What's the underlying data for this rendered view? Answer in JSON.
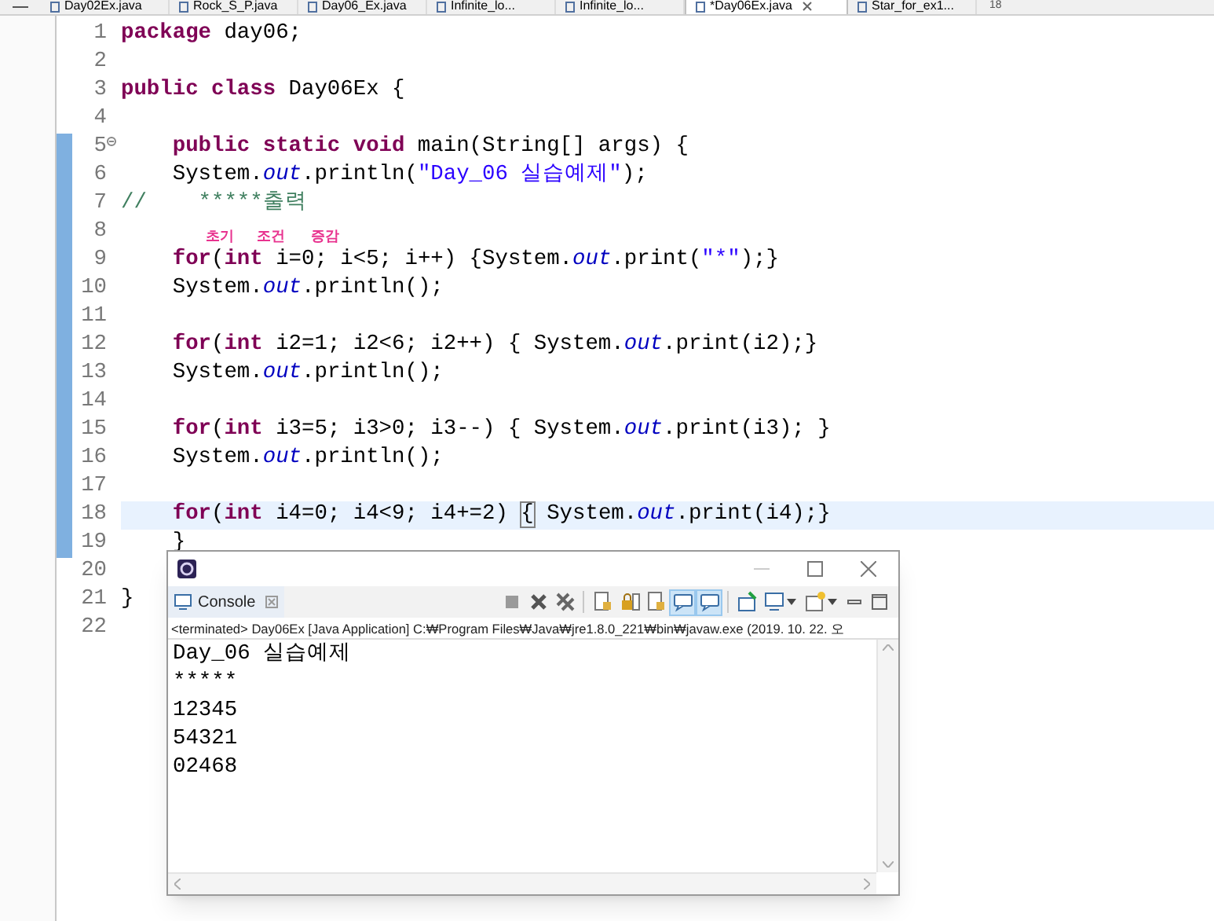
{
  "tabs": [
    {
      "label": "Day02Ex.java",
      "selected": false,
      "closable": false
    },
    {
      "label": "Rock_S_P.java",
      "selected": false,
      "closable": false
    },
    {
      "label": "Day06_Ex.java",
      "selected": false,
      "closable": false
    },
    {
      "label": "Infinite_lo...",
      "selected": false,
      "closable": false
    },
    {
      "label": "Infinite_lo...",
      "selected": false,
      "closable": false
    },
    {
      "label": "*Day06Ex.java",
      "selected": true,
      "closable": true
    },
    {
      "label": "Star_for_ex1...",
      "selected": false,
      "closable": false
    }
  ],
  "overflow_count": "18",
  "editor": {
    "lines": [
      {
        "number": "1",
        "tokens": [
          {
            "kind": "kw",
            "text": "package"
          },
          {
            "kind": "plain",
            "text": " day06;"
          }
        ]
      },
      {
        "number": "2"
      },
      {
        "number": "3",
        "tokens": [
          {
            "kind": "kw",
            "text": "public class"
          },
          {
            "kind": "plain",
            "text": " Day06Ex {"
          }
        ]
      },
      {
        "number": "4"
      },
      {
        "number": "5",
        "folding": true,
        "tokens": [
          {
            "kind": "kw",
            "text": "    public static void"
          },
          {
            "kind": "plain",
            "text": " main(String[] args) {"
          }
        ]
      },
      {
        "number": "6",
        "tokens": [
          {
            "kind": "plain",
            "text": "    System."
          },
          {
            "kind": "field",
            "text": "out"
          },
          {
            "kind": "plain",
            "text": ".println("
          },
          {
            "kind": "str",
            "text": "\"Day_06 실습예제\""
          },
          {
            "kind": "plain",
            "text": ");"
          }
        ]
      },
      {
        "number": "7",
        "tokens": [
          {
            "kind": "comment",
            "text": "//    *****출력"
          }
        ]
      },
      {
        "number": "8",
        "annotations": [
          "초기",
          "조건",
          "증감"
        ]
      },
      {
        "number": "9",
        "tokens": [
          {
            "kind": "kw",
            "text": "    for"
          },
          {
            "kind": "plain",
            "text": "("
          },
          {
            "kind": "kw",
            "text": "int"
          },
          {
            "kind": "plain",
            "text": " i=0; i<5; i++) {System."
          },
          {
            "kind": "field",
            "text": "out"
          },
          {
            "kind": "plain",
            "text": ".print("
          },
          {
            "kind": "str",
            "text": "\"*\""
          },
          {
            "kind": "plain",
            "text": ");}"
          }
        ]
      },
      {
        "number": "10",
        "tokens": [
          {
            "kind": "plain",
            "text": "    System."
          },
          {
            "kind": "field",
            "text": "out"
          },
          {
            "kind": "plain",
            "text": ".println();"
          }
        ]
      },
      {
        "number": "11"
      },
      {
        "number": "12",
        "tokens": [
          {
            "kind": "kw",
            "text": "    for"
          },
          {
            "kind": "plain",
            "text": "("
          },
          {
            "kind": "kw",
            "text": "int"
          },
          {
            "kind": "plain",
            "text": " i2=1; i2<6; i2++) { System."
          },
          {
            "kind": "field",
            "text": "out"
          },
          {
            "kind": "plain",
            "text": ".print(i2);}"
          }
        ]
      },
      {
        "number": "13",
        "tokens": [
          {
            "kind": "plain",
            "text": "    System."
          },
          {
            "kind": "field",
            "text": "out"
          },
          {
            "kind": "plain",
            "text": ".println();"
          }
        ]
      },
      {
        "number": "14"
      },
      {
        "number": "15",
        "tokens": [
          {
            "kind": "kw",
            "text": "    for"
          },
          {
            "kind": "plain",
            "text": "("
          },
          {
            "kind": "kw",
            "text": "int"
          },
          {
            "kind": "plain",
            "text": " i3=5; i3>0; i3--) { System."
          },
          {
            "kind": "field",
            "text": "out"
          },
          {
            "kind": "plain",
            "text": ".print(i3); }"
          }
        ]
      },
      {
        "number": "16",
        "tokens": [
          {
            "kind": "plain",
            "text": "    System."
          },
          {
            "kind": "field",
            "text": "out"
          },
          {
            "kind": "plain",
            "text": ".println();"
          }
        ]
      },
      {
        "number": "17"
      },
      {
        "number": "18",
        "current": true,
        "tokens": [
          {
            "kind": "kw",
            "text": "    for"
          },
          {
            "kind": "plain",
            "text": "("
          },
          {
            "kind": "kw",
            "text": "int"
          },
          {
            "kind": "plain",
            "text": " i4=0; i4<9; i4+=2) "
          },
          {
            "kind": "match",
            "text": "{"
          },
          {
            "kind": "plain",
            "text": " System."
          },
          {
            "kind": "field",
            "text": "out"
          },
          {
            "kind": "plain",
            "text": ".print(i4);}"
          }
        ]
      },
      {
        "number": "19",
        "tokens": [
          {
            "kind": "plain",
            "text": "    }"
          }
        ]
      },
      {
        "number": "20"
      },
      {
        "number": "21",
        "tokens": [
          {
            "kind": "plain",
            "text": "}"
          }
        ]
      },
      {
        "number": "22"
      }
    ]
  },
  "console": {
    "tab": "Console",
    "toolbar": [
      {
        "kind": "stop",
        "on": false
      },
      {
        "kind": "remove",
        "on": false
      },
      {
        "kind": "removeall",
        "on": false
      },
      {
        "kind": "doc",
        "on": false
      },
      {
        "kind": "lock",
        "on": false
      },
      {
        "kind": "doc",
        "on": false
      },
      {
        "kind": "bubble",
        "on": true
      },
      {
        "kind": "bubble",
        "on": true
      },
      {
        "kind": "pin",
        "on": false
      },
      {
        "kind": "monitor",
        "on": false
      },
      {
        "kind": "newwin",
        "on": false
      }
    ],
    "description": "<terminated> Day06Ex [Java Application] C:₩Program Files₩Java₩jre1.8.0_221₩bin₩javaw.exe (2019. 10. 22. 오",
    "output": [
      "Day_06 실습예제",
      "*****",
      "12345",
      "54321",
      "02468"
    ]
  }
}
